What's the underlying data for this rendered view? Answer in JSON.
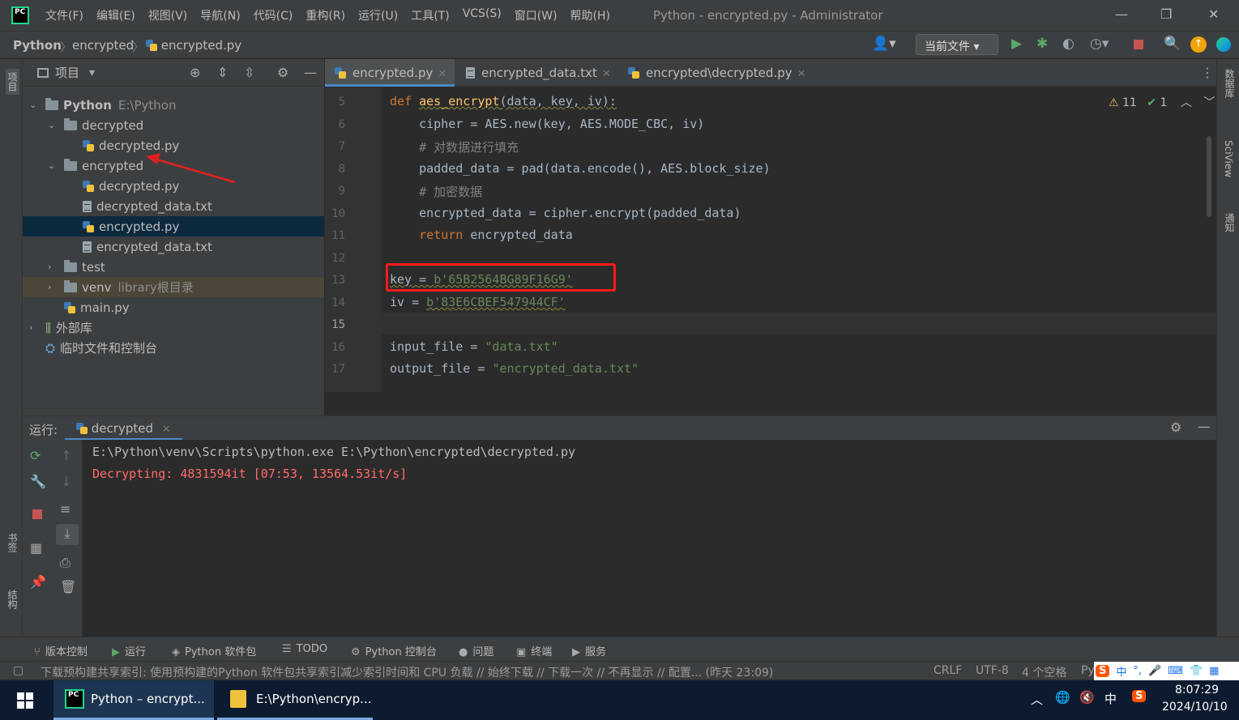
{
  "window": {
    "title": "Python - encrypted.py - Administrator",
    "logo_text": "PC",
    "minimize": "—",
    "restore": "❐",
    "close": "✕"
  },
  "menu": [
    "文件(F)",
    "编辑(E)",
    "视图(V)",
    "导航(N)",
    "代码(C)",
    "重构(R)",
    "运行(U)",
    "工具(T)",
    "VCS(S)",
    "窗口(W)",
    "帮助(H)"
  ],
  "breadcrumb": {
    "root": "Python",
    "folder": "encrypted",
    "file": "encrypted.py"
  },
  "toolbar": {
    "run_config": "当前文件 ▾"
  },
  "left_strip": {
    "project_tab": "项目",
    "bookmarks_tab": "书签",
    "structure_tab": "结构"
  },
  "right_strip": {
    "database_tab": "数据库",
    "sciview_tab": "SciView",
    "notifications_tab": "通知"
  },
  "project": {
    "header": "项目",
    "tree": [
      {
        "label": "Python",
        "extra": "E:\\Python",
        "depth": 0,
        "arrow": "⌄",
        "type": "folder",
        "bold": true
      },
      {
        "label": "decrypted",
        "extra": "",
        "depth": 1,
        "arrow": "⌄",
        "type": "folder"
      },
      {
        "label": "decrypted.py",
        "extra": "",
        "depth": 2,
        "arrow": "",
        "type": "py"
      },
      {
        "label": "encrypted",
        "extra": "",
        "depth": 1,
        "arrow": "⌄",
        "type": "folder"
      },
      {
        "label": "decrypted.py",
        "extra": "",
        "depth": 2,
        "arrow": "",
        "type": "py"
      },
      {
        "label": "decrypted_data.txt",
        "extra": "",
        "depth": 2,
        "arrow": "",
        "type": "txt"
      },
      {
        "label": "encrypted.py",
        "extra": "",
        "depth": 2,
        "arrow": "",
        "type": "py",
        "selected": true
      },
      {
        "label": "encrypted_data.txt",
        "extra": "",
        "depth": 2,
        "arrow": "",
        "type": "txt"
      },
      {
        "label": "test",
        "extra": "",
        "depth": 1,
        "arrow": "›",
        "type": "folder"
      },
      {
        "label": "venv",
        "extra": "library根目录",
        "depth": 1,
        "arrow": "›",
        "type": "folder",
        "excluded": true
      },
      {
        "label": "main.py",
        "extra": "",
        "depth": 1,
        "arrow": "",
        "type": "py"
      },
      {
        "label": "外部库",
        "extra": "",
        "depth": 0,
        "arrow": "›",
        "type": "lib"
      },
      {
        "label": "临时文件和控制台",
        "extra": "",
        "depth": 0,
        "arrow": "",
        "type": "scratch"
      }
    ]
  },
  "editor": {
    "tabs": [
      {
        "label": "encrypted.py",
        "type": "py",
        "active": true
      },
      {
        "label": "encrypted_data.txt",
        "type": "txt"
      },
      {
        "label": "encrypted\\decrypted.py",
        "type": "py"
      }
    ],
    "inspections": {
      "warnings": "11",
      "ok": "1"
    },
    "lines": [
      {
        "num": "5",
        "html_key": "l5"
      },
      {
        "num": "6",
        "html_key": "l6"
      },
      {
        "num": "7",
        "html_key": "l7"
      },
      {
        "num": "8",
        "html_key": "l8"
      },
      {
        "num": "9",
        "html_key": "l9"
      },
      {
        "num": "10",
        "html_key": "l10"
      },
      {
        "num": "11",
        "html_key": "l11"
      },
      {
        "num": "12",
        "html_key": "l12"
      },
      {
        "num": "13",
        "html_key": "l13"
      },
      {
        "num": "14",
        "html_key": "l14"
      },
      {
        "num": "15",
        "html_key": "l15"
      },
      {
        "num": "16",
        "html_key": "l16"
      },
      {
        "num": "17",
        "html_key": "l17"
      }
    ],
    "code": {
      "def_kw": "def",
      "fn_name": "aes_encrypt",
      "l5_args": "(data, key, iv):",
      "l6": "    cipher = AES.new(key, AES.MODE_CBC, iv)",
      "l7": "    # 对数据进行填充",
      "l8": "    padded_data = pad(data.encode(), AES.block_size)",
      "l9": "    # 加密数据",
      "l10": "    encrypted_data = cipher.encrypt(padded_data)",
      "return_kw": "return",
      "l11_rest": " encrypted_data",
      "l13_var": "key",
      "l13_eq": " = ",
      "l13_str": "b'65B2564BG89F16G9'",
      "l14_var": "iv",
      "l14_eq": " = ",
      "l14_str": "b'83E6CBEF547944CF'",
      "l16_var": "input_file",
      "l16_eq": " = ",
      "l16_str": "\"data.txt\"",
      "l17_var": "output_file",
      "l17_eq": " = ",
      "l17_str": "\"encrypted_data.txt\""
    }
  },
  "run": {
    "label": "运行:",
    "tab": "decrypted",
    "output": [
      {
        "text": "E:\\Python\\venv\\Scripts\\python.exe E:\\Python\\encrypted\\decrypted.py",
        "color": "#bbbbbb"
      },
      {
        "text": "Decrypting: 4831594it [07:53, 13564.53it/s]",
        "color": "#ff6b68"
      }
    ]
  },
  "bottom_tabs": [
    "版本控制",
    "运行",
    "Python 软件包",
    "TODO",
    "Python 控制台",
    "问题",
    "终端",
    "服务"
  ],
  "status": {
    "message": "下载预构建共享索引: 使用预构建的Python 软件包共享索引减少索引时间和 CPU 负载 // 始终下载 // 下载一次 // 不再显示 // 配置... (昨天 23:09)",
    "line_sep": "CRLF",
    "encoding": "UTF-8",
    "indent": "4 个空格",
    "interpreter": "Py"
  },
  "taskbar": {
    "apps": [
      {
        "label": "Python – encrypt..."
      },
      {
        "label": "E:\\Python\\encryp..."
      }
    ],
    "ime": "中",
    "time": "8:07:29",
    "date": "2024/10/10"
  },
  "colors": {
    "accent": "#4a88c7",
    "highlight_box": "#ff1a1a",
    "annotation_arrow": "#e02020"
  }
}
